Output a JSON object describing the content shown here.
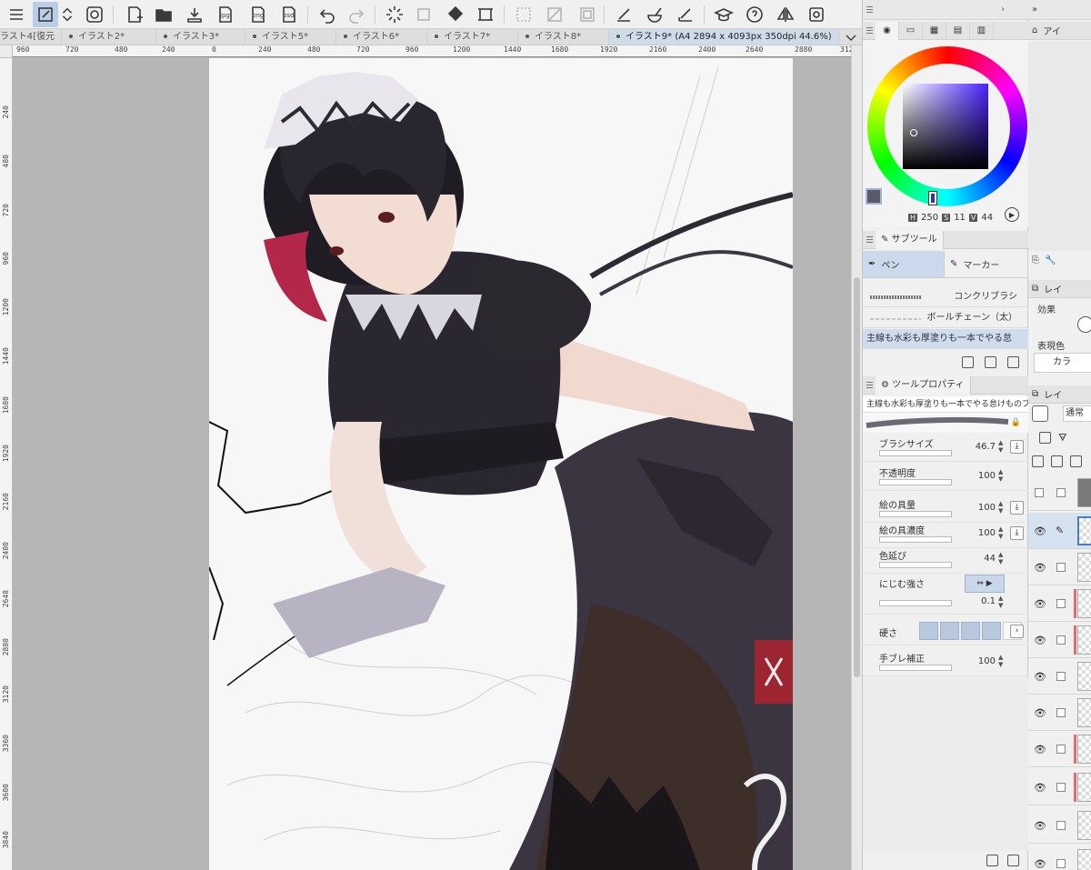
{
  "toolbar": {
    "icons": [
      "menu-icon",
      "edit-icon",
      "arrows-icon",
      "spiral-icon",
      "new-file-icon",
      "open-file-icon",
      "save-icon",
      "jpg-export-icon",
      "png-export-icon",
      "psd-export-icon",
      "undo-icon",
      "redo-icon",
      "transform-icon",
      "clear-icon",
      "fill-icon",
      "crop-icon",
      "selection-icon",
      "gradient-icon",
      "select-all-icon",
      "pen-ruler-icon",
      "paint-icon",
      "ruler-icon",
      "learn-icon",
      "help-icon",
      "flip-icon",
      "screenshot-icon"
    ],
    "jpg": "jpg",
    "png": "png",
    "psd": "psd"
  },
  "tabs": [
    {
      "label": "ラスト4[復元"
    },
    {
      "label": "イラスト2*"
    },
    {
      "label": "イラスト3*"
    },
    {
      "label": "イラスト5*"
    },
    {
      "label": "イラスト6*"
    },
    {
      "label": "イラスト7*"
    },
    {
      "label": "イラスト8*"
    },
    {
      "label": "イラスト9* (A4 2894 x 4093px 350dpi 44.6%)"
    }
  ],
  "ruler": {
    "top": [
      "960",
      "720",
      "480",
      "240",
      "0",
      "240",
      "480",
      "720",
      "960",
      "1200",
      "1440",
      "1680",
      "1920",
      "2160",
      "2400",
      "2640",
      "2880",
      "312"
    ],
    "left": [
      "240",
      "480",
      "720",
      "960",
      "1200",
      "1440",
      "1680",
      "1920",
      "2160",
      "2400",
      "2640",
      "2880",
      "3120",
      "3360",
      "3600",
      "3840"
    ]
  },
  "color": {
    "h_label": "H",
    "h": "250",
    "s_label": "S",
    "s": "11",
    "v_label": "V",
    "v": "44",
    "main": "#5a5a6a",
    "sub": "#ffffff"
  },
  "subtool": {
    "title": "サブツール",
    "tabs": [
      {
        "label": "ペン"
      },
      {
        "label": "マーカー"
      }
    ],
    "brushes": [
      {
        "name": "コンクリブラシ"
      },
      {
        "name": "ボールチェーン（太）"
      },
      {
        "name": "主線も水彩も厚塗りも一本でやる怠"
      }
    ]
  },
  "toolprop": {
    "title": "ツールプロパティ",
    "brush_name": "主線も水彩も厚塗りも一本でやる怠けものブラシ",
    "rows": [
      {
        "label": "ブラシサイズ",
        "value": "46.7"
      },
      {
        "label": "不透明度",
        "value": "100"
      },
      {
        "label": "絵の具量",
        "value": "100"
      },
      {
        "label": "絵の具濃度",
        "value": "100"
      },
      {
        "label": "色延び",
        "value": "44"
      },
      {
        "label": "にじむ強さ",
        "value": "0.1"
      },
      {
        "label": "硬さ",
        "value": ""
      },
      {
        "label": "手ブレ補正",
        "value": "100"
      }
    ]
  },
  "right": {
    "top_label": "アイ",
    "layer_label": "レイ",
    "effect_label": "効果",
    "color_label": "表現色",
    "color_value": "カラ",
    "layer2_label": "レイ",
    "blend_value": "通常"
  }
}
